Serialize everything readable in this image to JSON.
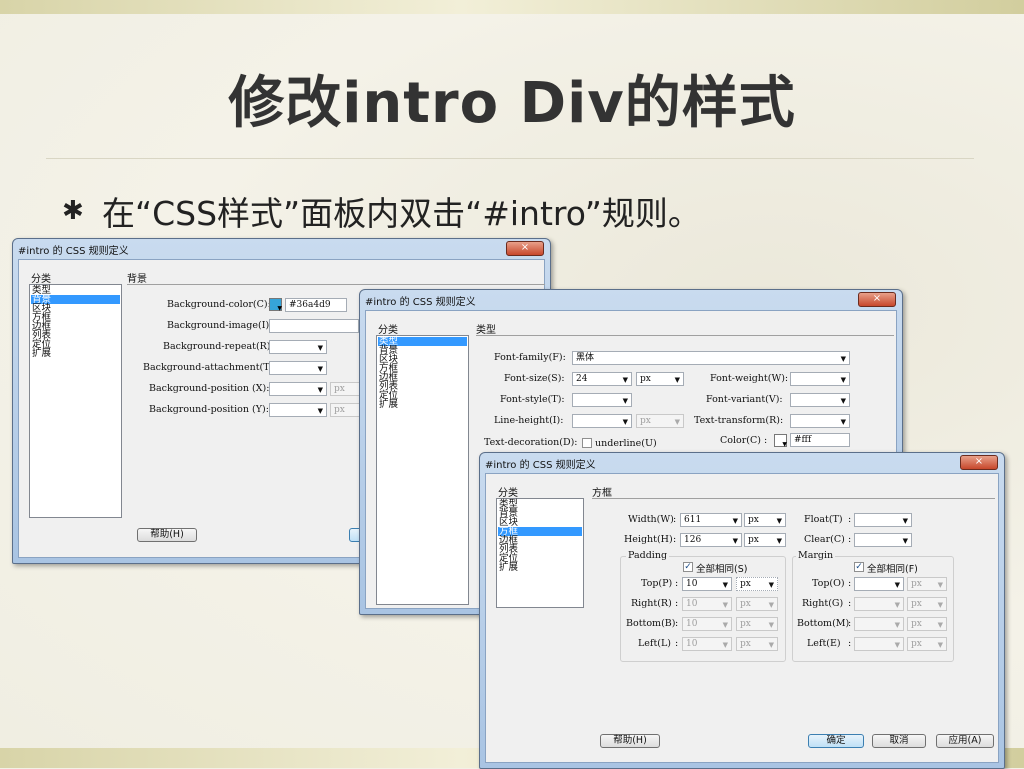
{
  "slide": {
    "title": "修改intro Div的样式",
    "bullet": "✱",
    "subtitle": "在“CSS样式”面板内双击“#intro”规则。"
  },
  "dialogs": {
    "common": {
      "title": "#intro 的 CSS 规则定义",
      "close": "×",
      "category_header": "分类",
      "categories": [
        "类型",
        "背景",
        "区块",
        "方框",
        "边框",
        "列表",
        "定位",
        "扩展"
      ],
      "help": "帮助(H)",
      "ok": "确定",
      "cancel": "取消",
      "apply": "应用(A)"
    },
    "background": {
      "section": "背景",
      "selected_index": 1,
      "fields": {
        "color_label": "Background-color(C):",
        "color_value": "#36a4d9",
        "color_hex": "#36a4d9",
        "image_label": "Background-image(I):",
        "repeat_label": "Background-repeat(R):",
        "attachment_label": "Background-attachment(T):",
        "posx_label": "Background-position (X):",
        "posy_label": "Background-position (Y):",
        "unit_px": "px"
      }
    },
    "type": {
      "section": "类型",
      "selected_index": 0,
      "fields": {
        "font_family_label": "Font-family(F):",
        "font_family_value": "黑体",
        "font_size_label": "Font-size(S):",
        "font_size_value": "24",
        "font_size_unit": "px",
        "font_weight_label": "Font-weight(W):",
        "font_style_label": "Font-style(T):",
        "font_variant_label": "Font-variant(V):",
        "line_height_label": "Line-height(I):",
        "line_height_unit": "px",
        "text_transform_label": "Text-transform(R):",
        "text_decoration_label": "Text-decoration(D):",
        "underline_label": "underline(U)",
        "color_label": "Color(C) :",
        "color_value": "#fff"
      }
    },
    "box": {
      "section": "方框",
      "selected_index": 3,
      "fields": {
        "width_label": "Width(W)",
        "width_value": "611",
        "height_label": "Height(H)",
        "height_value": "126",
        "unit_px": "px",
        "float_label": "Float(T)",
        "clear_label": "Clear(C)",
        "padding_label": "Padding",
        "margin_label": "Margin",
        "same_padding": "全部相同(S)",
        "same_margin": "全部相同(F)",
        "padding": {
          "top_label": "Top(P)",
          "top_value": "10",
          "right_label": "Right(R)",
          "right_value": "10",
          "bottom_label": "Bottom(B)",
          "bottom_value": "10",
          "left_label": "Left(L)",
          "left_value": "10"
        },
        "margin": {
          "top_label": "Top(O)",
          "right_label": "Right(G)",
          "bottom_label": "Bottom(M)",
          "left_label": "Left(E)"
        }
      }
    }
  }
}
